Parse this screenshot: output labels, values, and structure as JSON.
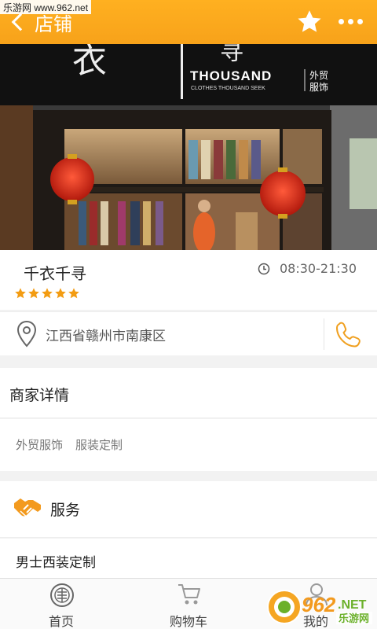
{
  "watermark_top": "乐游网 www.962.net",
  "header": {
    "title": "店铺"
  },
  "banner": {
    "sign_brand": "THOUSAND",
    "sign_sub": "CLOTHES THOUSAND SEEK",
    "sign_cn_1": "外贸",
    "sign_cn_2": "服饰",
    "sign_big": "衣",
    "sign_big2": "寻"
  },
  "shop": {
    "name": "千衣千寻",
    "hours": "08:30-21:30",
    "rating": 5,
    "address": "江西省赣州市南康区"
  },
  "details": {
    "heading": "商家详情",
    "tags": [
      "外贸服饰",
      "服装定制"
    ]
  },
  "service": {
    "heading": "服务",
    "items": [
      "男士西装定制"
    ]
  },
  "tabbar": {
    "tabs": [
      {
        "label": "首页"
      },
      {
        "label": "购物车"
      },
      {
        "label": "我的"
      }
    ]
  },
  "watermark_bottom": {
    "brand": "962",
    "suffix": ".NET",
    "cn": "乐游网"
  },
  "colors": {
    "accent": "#f7a21a",
    "star": "#f39c12"
  }
}
